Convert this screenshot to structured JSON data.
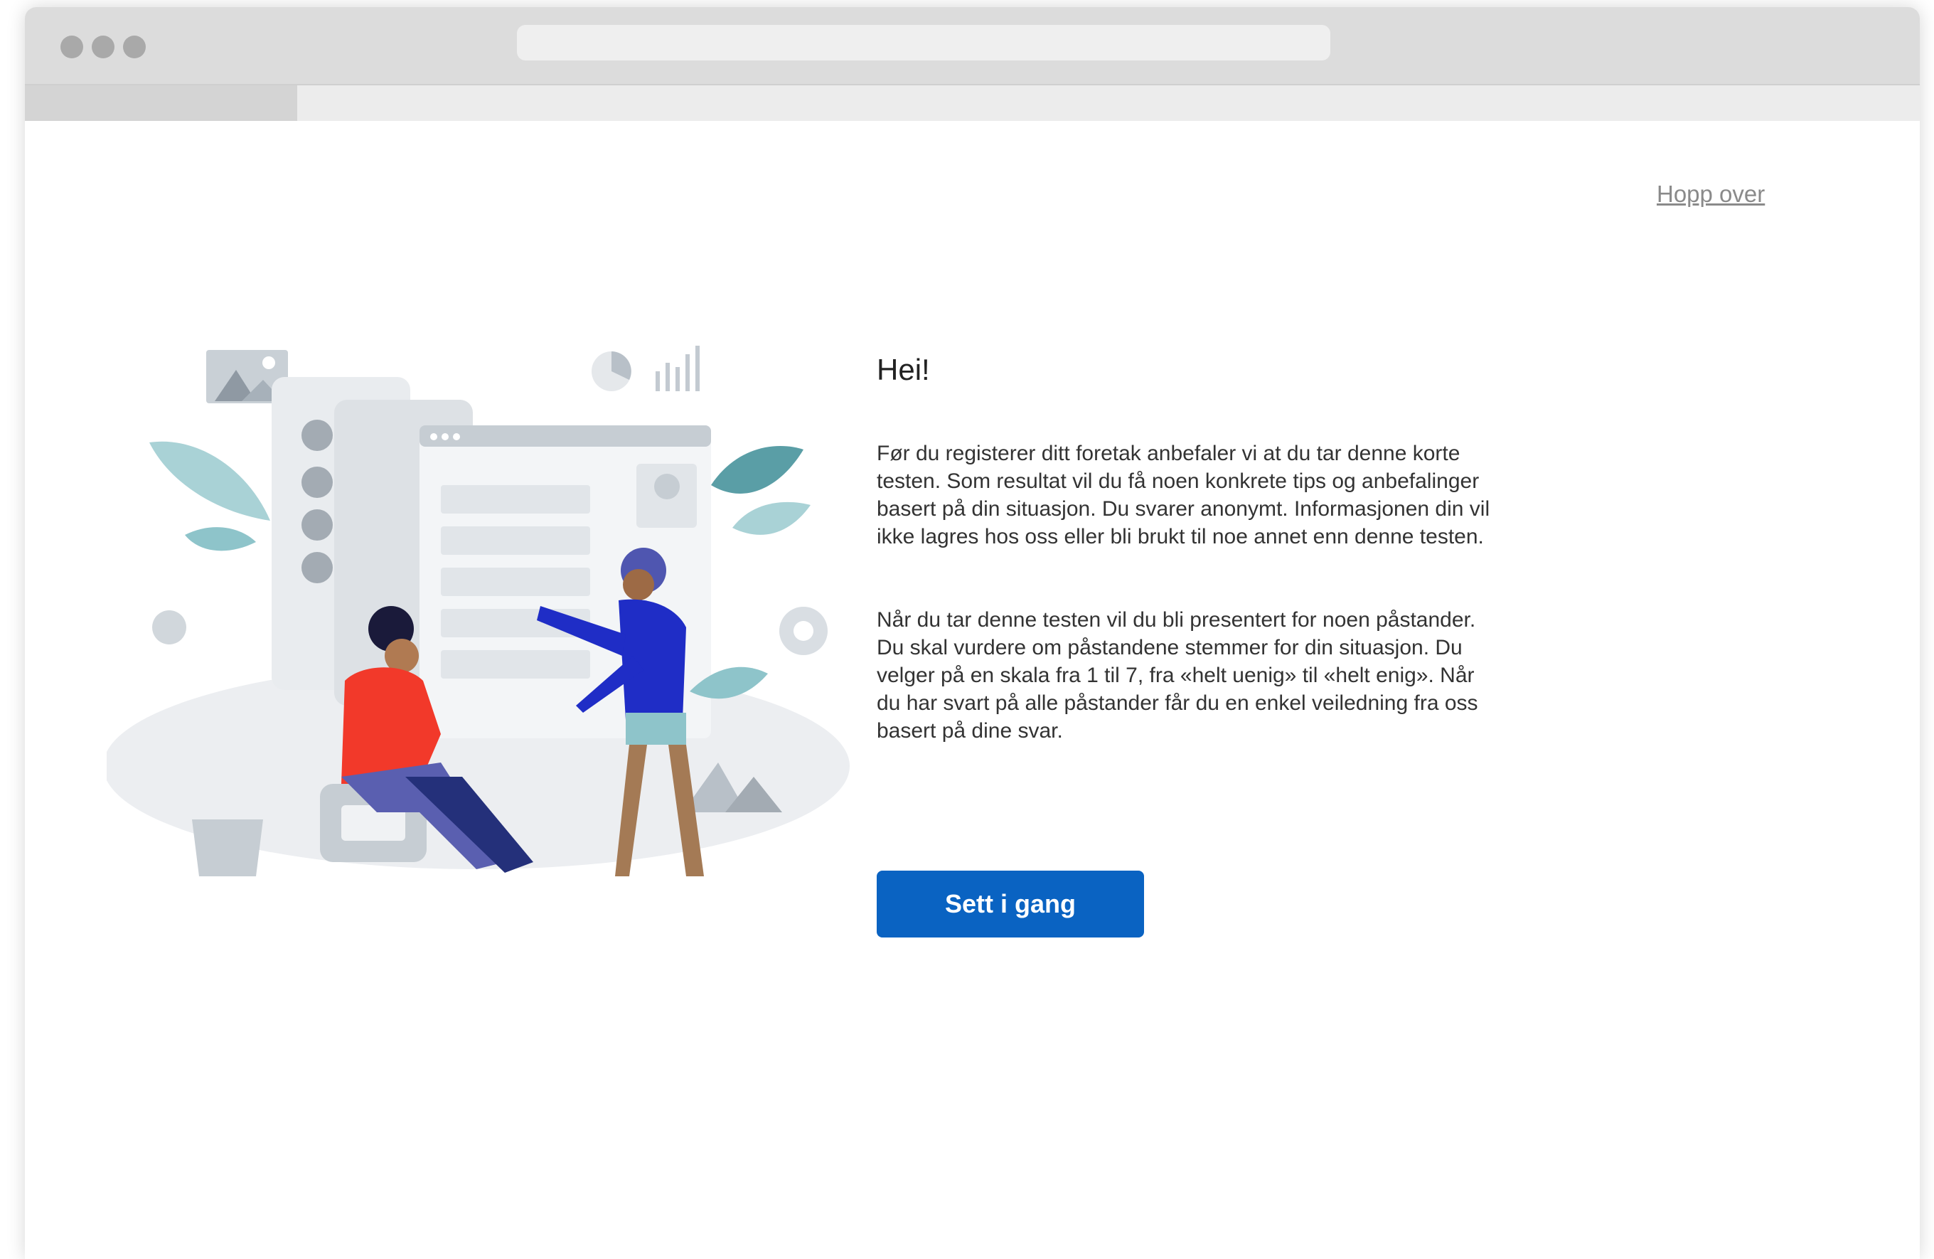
{
  "header": {
    "skip_label": "Hopp over"
  },
  "intro": {
    "heading": "Hei!",
    "paragraph_1": "Før du registerer ditt foretak anbefaler vi at du tar denne korte testen. Som resultat vil du få noen konkrete tips og anbefalinger basert på din situasjon. Du svarer anonymt. Informasjonen din vil ikke lagres hos oss eller bli brukt til noe annet enn denne testen.",
    "paragraph_2": "Når du tar denne testen vil du bli presentert for noen påstander. Du skal vurdere om påstandene stemmer for din situasjon. Du velger på en skala fra 1 til 7, fra «helt uenig» til «helt enig». Når du har svart på alle påstander får du en enkel veiledning fra oss basert på dine svar.",
    "start_button_label": "Sett i gang"
  },
  "colors": {
    "primary_button": "#0a63c2",
    "skip_link": "#8a8a8a",
    "heading_text": "#222222",
    "body_text": "#333333"
  },
  "illustration": {
    "description_icon": "people-dashboard-illustration"
  }
}
